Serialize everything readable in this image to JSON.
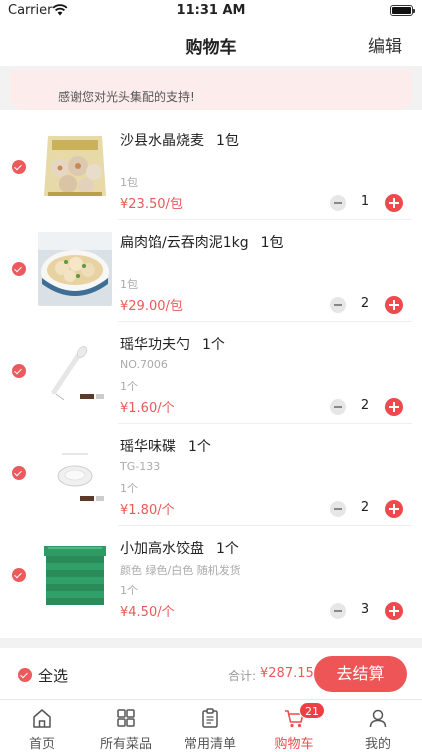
{
  "status_bar": {
    "carrier": "Carrier",
    "time": "11:31 AM"
  },
  "header": {
    "title": "购物车",
    "edit_label": "编辑"
  },
  "notice": {
    "text": "感谢您对光头集配的支持!"
  },
  "items": [
    {
      "name": "沙县水晶烧麦",
      "unit": "1包",
      "spec": "",
      "per": "1包",
      "price": "¥23.50/包",
      "qty": "1"
    },
    {
      "name": "扁肉馅/云吞肉泥1kg",
      "unit": "1包",
      "spec": "",
      "per": "1包",
      "price": "¥29.00/包",
      "qty": "2"
    },
    {
      "name": "瑶华功夫勺",
      "unit": "1个",
      "spec": "NO.7006",
      "per": "1个",
      "price": "¥1.60/个",
      "qty": "2"
    },
    {
      "name": "瑶华味碟",
      "unit": "1个",
      "spec": "TG-133",
      "per": "1个",
      "price": "¥1.80/个",
      "qty": "2"
    },
    {
      "name": "小加高水饺盘",
      "unit": "1个",
      "spec": "颜色 绿色/白色 随机发货",
      "per": "1个",
      "price": "¥4.50/个",
      "qty": "3"
    }
  ],
  "checkout": {
    "select_all_label": "全选",
    "total_label": "合计:",
    "total_value": "¥287.15",
    "button_label": "去结算"
  },
  "tabs": [
    {
      "label": "首页",
      "icon": "home-icon"
    },
    {
      "label": "所有菜品",
      "icon": "grid-icon"
    },
    {
      "label": "常用清单",
      "icon": "clipboard-icon"
    },
    {
      "label": "购物车",
      "icon": "cart-icon",
      "badge": "21",
      "active": true
    },
    {
      "label": "我的",
      "icon": "person-icon"
    }
  ],
  "colors": {
    "accent": "#ee4a4d",
    "price": "#e75a57",
    "notice_bg": "#fdecec"
  }
}
